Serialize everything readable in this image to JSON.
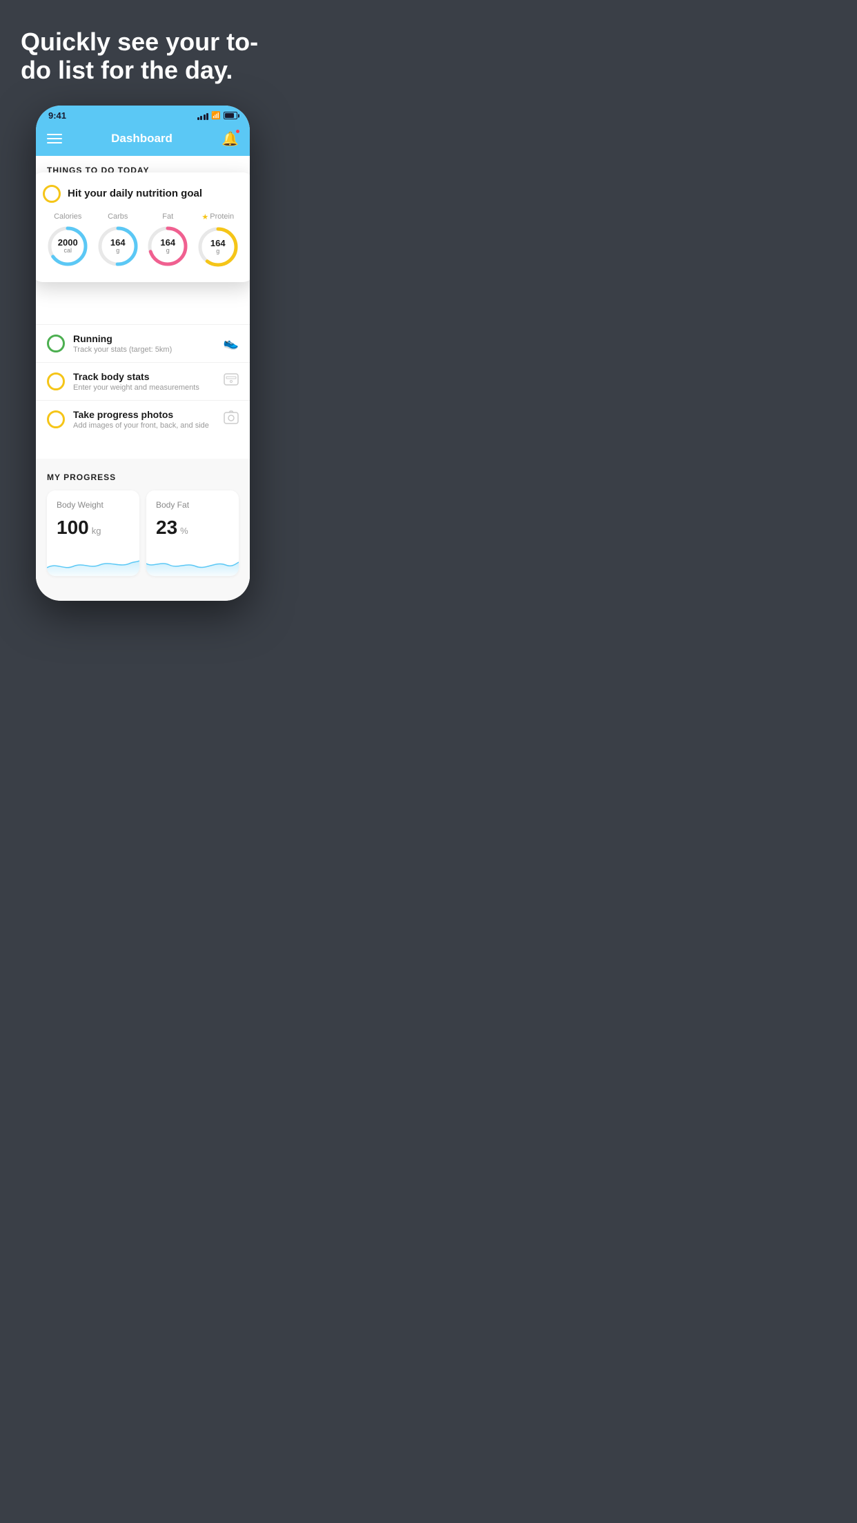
{
  "hero": {
    "title": "Quickly see your to-do list for the day."
  },
  "phone": {
    "status_bar": {
      "time": "9:41"
    },
    "header": {
      "title": "Dashboard"
    },
    "things_section": {
      "label": "THINGS TO DO TODAY"
    },
    "nutrition_card": {
      "title": "Hit your daily nutrition goal",
      "items": [
        {
          "label": "Calories",
          "value": "2000",
          "unit": "cal",
          "color": "#5bc8f5",
          "track": 0.65,
          "star": false
        },
        {
          "label": "Carbs",
          "value": "164",
          "unit": "g",
          "color": "#5bc8f5",
          "track": 0.5,
          "star": false
        },
        {
          "label": "Fat",
          "value": "164",
          "unit": "g",
          "color": "#f06090",
          "track": 0.7,
          "star": false
        },
        {
          "label": "Protein",
          "value": "164",
          "unit": "g",
          "color": "#f5c518",
          "track": 0.6,
          "star": true
        }
      ]
    },
    "todo_items": [
      {
        "title": "Running",
        "subtitle": "Track your stats (target: 5km)",
        "circle_color": "green",
        "icon": "shoe"
      },
      {
        "title": "Track body stats",
        "subtitle": "Enter your weight and measurements",
        "circle_color": "yellow",
        "icon": "scale"
      },
      {
        "title": "Take progress photos",
        "subtitle": "Add images of your front, back, and side",
        "circle_color": "yellow",
        "icon": "photo"
      }
    ],
    "progress_section": {
      "label": "MY PROGRESS",
      "cards": [
        {
          "title": "Body Weight",
          "value": "100",
          "unit": "kg"
        },
        {
          "title": "Body Fat",
          "value": "23",
          "unit": "%"
        }
      ]
    }
  }
}
